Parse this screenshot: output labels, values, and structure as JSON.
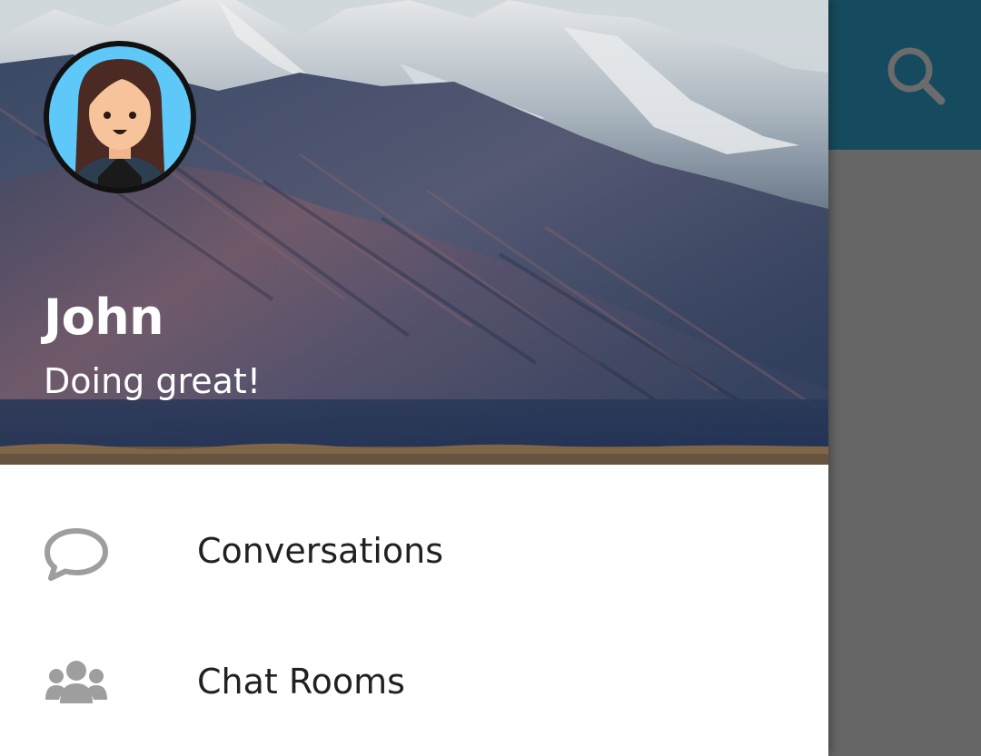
{
  "colors": {
    "appbar": "#164a5e",
    "scrim": "#666666",
    "drawer_bg": "#ffffff",
    "icon_gray": "#9e9e9e",
    "label_text": "#212121"
  },
  "toolbar": {
    "search_icon": "search-icon"
  },
  "drawer": {
    "header": {
      "name": "John",
      "status": "Doing great!",
      "avatar_icon": "user-avatar"
    },
    "items": [
      {
        "label": "Conversations",
        "icon": "chat-bubble-icon"
      },
      {
        "label": "Chat Rooms",
        "icon": "group-icon"
      }
    ]
  }
}
